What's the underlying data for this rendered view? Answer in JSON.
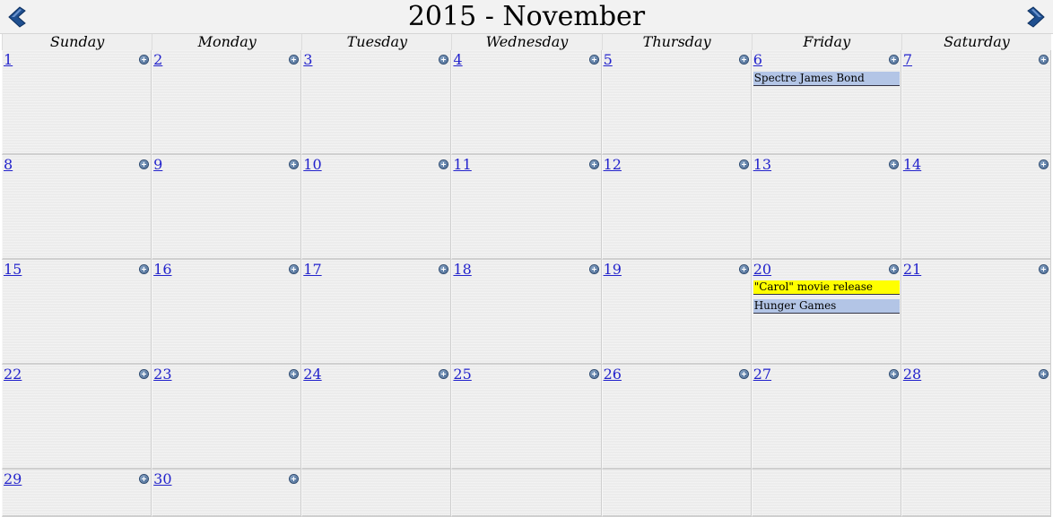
{
  "calendar": {
    "title": "2015 - November",
    "nav": {
      "prev_icon": "left-arrow-icon",
      "next_icon": "right-arrow-icon"
    },
    "weekdays": [
      "Sunday",
      "Monday",
      "Tuesday",
      "Wednesday",
      "Thursday",
      "Friday",
      "Saturday"
    ],
    "days": [
      "1",
      "2",
      "3",
      "4",
      "5",
      "6",
      "7",
      "8",
      "9",
      "10",
      "11",
      "12",
      "13",
      "14",
      "15",
      "16",
      "17",
      "18",
      "19",
      "20",
      "21",
      "22",
      "23",
      "24",
      "25",
      "26",
      "27",
      "28",
      "29",
      "30"
    ],
    "events": {
      "nov6": [
        "Spectre James Bond"
      ],
      "nov20": [
        "\"Carol\" movie release",
        "Hunger Games"
      ]
    },
    "colors": {
      "event_blue": "#b3c5e6",
      "event_yellow": "#ffff00",
      "link": "#2222cc",
      "arrow": "#1f4f8f"
    }
  }
}
